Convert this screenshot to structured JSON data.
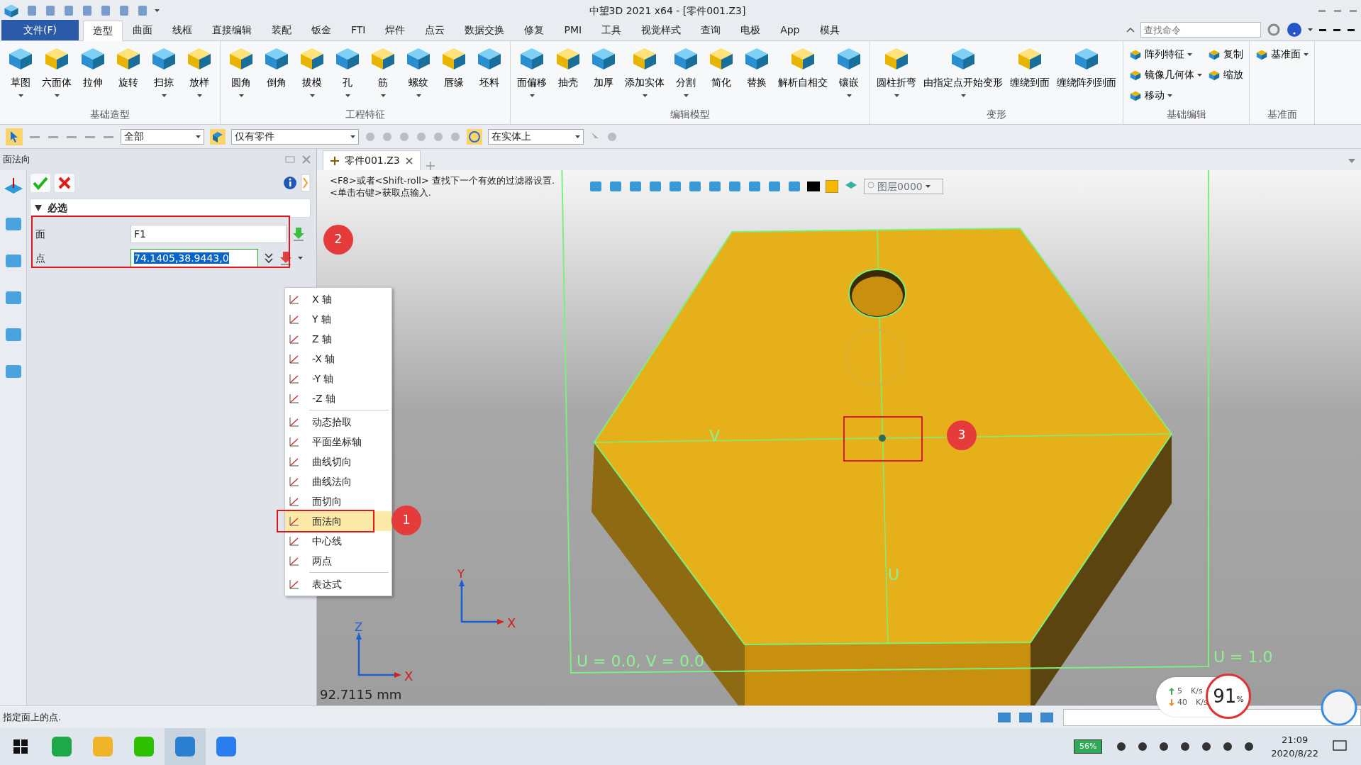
{
  "window": {
    "title": "中望3D 2021 x64 - [零件001.Z3]"
  },
  "menu_tabs": [
    {
      "label": "文件(F)",
      "kind": "file",
      "selected": false
    },
    {
      "label": "造型",
      "kind": "tab",
      "selected": true
    },
    {
      "label": "曲面",
      "kind": "tab",
      "selected": false
    },
    {
      "label": "线框",
      "kind": "tab",
      "selected": false
    },
    {
      "label": "直接编辑",
      "kind": "tab",
      "selected": false
    },
    {
      "label": "装配",
      "kind": "tab",
      "selected": false
    },
    {
      "label": "钣金",
      "kind": "tab",
      "selected": false
    },
    {
      "label": "FTI",
      "kind": "tab",
      "selected": false
    },
    {
      "label": "焊件",
      "kind": "tab",
      "selected": false
    },
    {
      "label": "点云",
      "kind": "tab",
      "selected": false
    },
    {
      "label": "数据交换",
      "kind": "tab",
      "selected": false
    },
    {
      "label": "修复",
      "kind": "tab",
      "selected": false
    },
    {
      "label": "PMI",
      "kind": "tab",
      "selected": false
    },
    {
      "label": "工具",
      "kind": "tab",
      "selected": false
    },
    {
      "label": "视觉样式",
      "kind": "tab",
      "selected": false
    },
    {
      "label": "查询",
      "kind": "tab",
      "selected": false
    },
    {
      "label": "电极",
      "kind": "tab",
      "selected": false
    },
    {
      "label": "App",
      "kind": "tab",
      "selected": false
    },
    {
      "label": "模具",
      "kind": "tab",
      "selected": false
    }
  ],
  "search": {
    "placeholder": "查找命令"
  },
  "ribbon_groups": [
    {
      "label": "基础造型",
      "tools": [
        {
          "label": "草图",
          "kind": "large",
          "dropdown": true
        },
        {
          "label": "六面体",
          "kind": "large",
          "dropdown": true
        },
        {
          "label": "拉伸",
          "kind": "large",
          "dropdown": false
        },
        {
          "label": "旋转",
          "kind": "large",
          "dropdown": false
        },
        {
          "label": "扫掠",
          "kind": "large",
          "dropdown": true
        },
        {
          "label": "放样",
          "kind": "large",
          "dropdown": true
        }
      ]
    },
    {
      "label": "工程特征",
      "tools": [
        {
          "label": "圆角",
          "kind": "large",
          "dropdown": true
        },
        {
          "label": "倒角",
          "kind": "large",
          "dropdown": false
        },
        {
          "label": "拔模",
          "kind": "large",
          "dropdown": true
        },
        {
          "label": "孔",
          "kind": "large",
          "dropdown": true
        },
        {
          "label": "筋",
          "kind": "large",
          "dropdown": true
        },
        {
          "label": "螺纹",
          "kind": "large",
          "dropdown": true
        },
        {
          "label": "唇缘",
          "kind": "large",
          "dropdown": false
        },
        {
          "label": "坯料",
          "kind": "large",
          "dropdown": false
        }
      ]
    },
    {
      "label": "编辑模型",
      "tools": [
        {
          "label": "面偏移",
          "kind": "large",
          "dropdown": true
        },
        {
          "label": "抽壳",
          "kind": "large",
          "dropdown": false
        },
        {
          "label": "加厚",
          "kind": "large",
          "dropdown": false
        },
        {
          "label": "添加实体",
          "kind": "large",
          "dropdown": true
        },
        {
          "label": "分割",
          "kind": "large",
          "dropdown": true
        },
        {
          "label": "简化",
          "kind": "large",
          "dropdown": false
        },
        {
          "label": "替换",
          "kind": "large",
          "dropdown": false
        },
        {
          "label": "解析自相交",
          "kind": "large",
          "dropdown": false
        },
        {
          "label": "镶嵌",
          "kind": "large",
          "dropdown": true
        }
      ]
    },
    {
      "label": "变形",
      "tools": [
        {
          "label": "圆柱折弯",
          "kind": "large",
          "dropdown": true
        },
        {
          "label": "由指定点开始变形",
          "kind": "large",
          "dropdown": true
        },
        {
          "label": "缠绕到面",
          "kind": "large",
          "dropdown": false
        },
        {
          "label": "缠绕阵列到面",
          "kind": "large",
          "dropdown": false
        }
      ]
    },
    {
      "label": "基础编辑",
      "tools": [
        {
          "label": "阵列特征",
          "kind": "small",
          "dropdown": true
        },
        {
          "label": "镜像几何体",
          "kind": "small",
          "dropdown": true
        },
        {
          "label": "移动",
          "kind": "small",
          "dropdown": true
        },
        {
          "label": "复制",
          "kind": "small",
          "dropdown": false
        },
        {
          "label": "缩放",
          "kind": "small",
          "dropdown": false
        }
      ]
    },
    {
      "label": "基准面",
      "tools": [
        {
          "label": "基准面",
          "kind": "small",
          "dropdown": true
        }
      ]
    }
  ],
  "toolbar": {
    "filter": "全部",
    "scope": "仅有零件",
    "pick": "在实体上"
  },
  "panel": {
    "title": "面法向",
    "section": "必选",
    "expanded": true,
    "fields": [
      {
        "label": "面",
        "value": "F1",
        "selected": false
      },
      {
        "label": "点",
        "value": "74.1405,38.9443,0",
        "selected": true
      }
    ]
  },
  "doc_tab": {
    "label": "零件001.Z3"
  },
  "viewport": {
    "hints": [
      "<F8>或者<Shift-roll> 查找下一个有效的过滤器设置.",
      "<单击右键>获取点输入."
    ],
    "layer": "图层0000",
    "measure": "92.7115 mm",
    "uv_labels": [
      {
        "text": "V",
        "kind": "v"
      },
      {
        "text": "U",
        "kind": "u"
      },
      {
        "text": "U = 0.0, V = 0.0",
        "kind": "origin"
      },
      {
        "text": "U = 1.0",
        "kind": "end"
      }
    ],
    "triads": [
      {
        "labels": [
          "Y",
          "X"
        ]
      },
      {
        "labels": [
          "Z",
          "X"
        ]
      }
    ]
  },
  "context_menu": {
    "groups": [
      [
        {
          "label": "X 轴",
          "selected": false
        },
        {
          "label": "Y 轴",
          "selected": false
        },
        {
          "label": "Z 轴",
          "selected": false
        },
        {
          "label": "-X 轴",
          "selected": false
        },
        {
          "label": "-Y 轴",
          "selected": false
        },
        {
          "label": "-Z 轴",
          "selected": false
        }
      ],
      [
        {
          "label": "动态拾取",
          "selected": false
        },
        {
          "label": "平面坐标轴",
          "selected": false
        },
        {
          "label": "曲线切向",
          "selected": false
        },
        {
          "label": "曲线法向",
          "selected": false
        },
        {
          "label": "面切向",
          "selected": false
        },
        {
          "label": "面法向",
          "selected": true
        },
        {
          "label": "中心线",
          "selected": false
        },
        {
          "label": "两点",
          "selected": false
        }
      ],
      [
        {
          "label": "表达式",
          "selected": false
        }
      ]
    ]
  },
  "callouts": [
    "1",
    "2",
    "3"
  ],
  "net_monitor": {
    "up": "5",
    "up_unit": "K/s",
    "down": "40",
    "down_unit": "K/s",
    "percent": "91",
    "percent_sign": "%"
  },
  "status_bar": {
    "text": "指定面上的点."
  },
  "taskbar": {
    "battery": "56%",
    "time": "21:09",
    "date": "2020/8/22"
  }
}
